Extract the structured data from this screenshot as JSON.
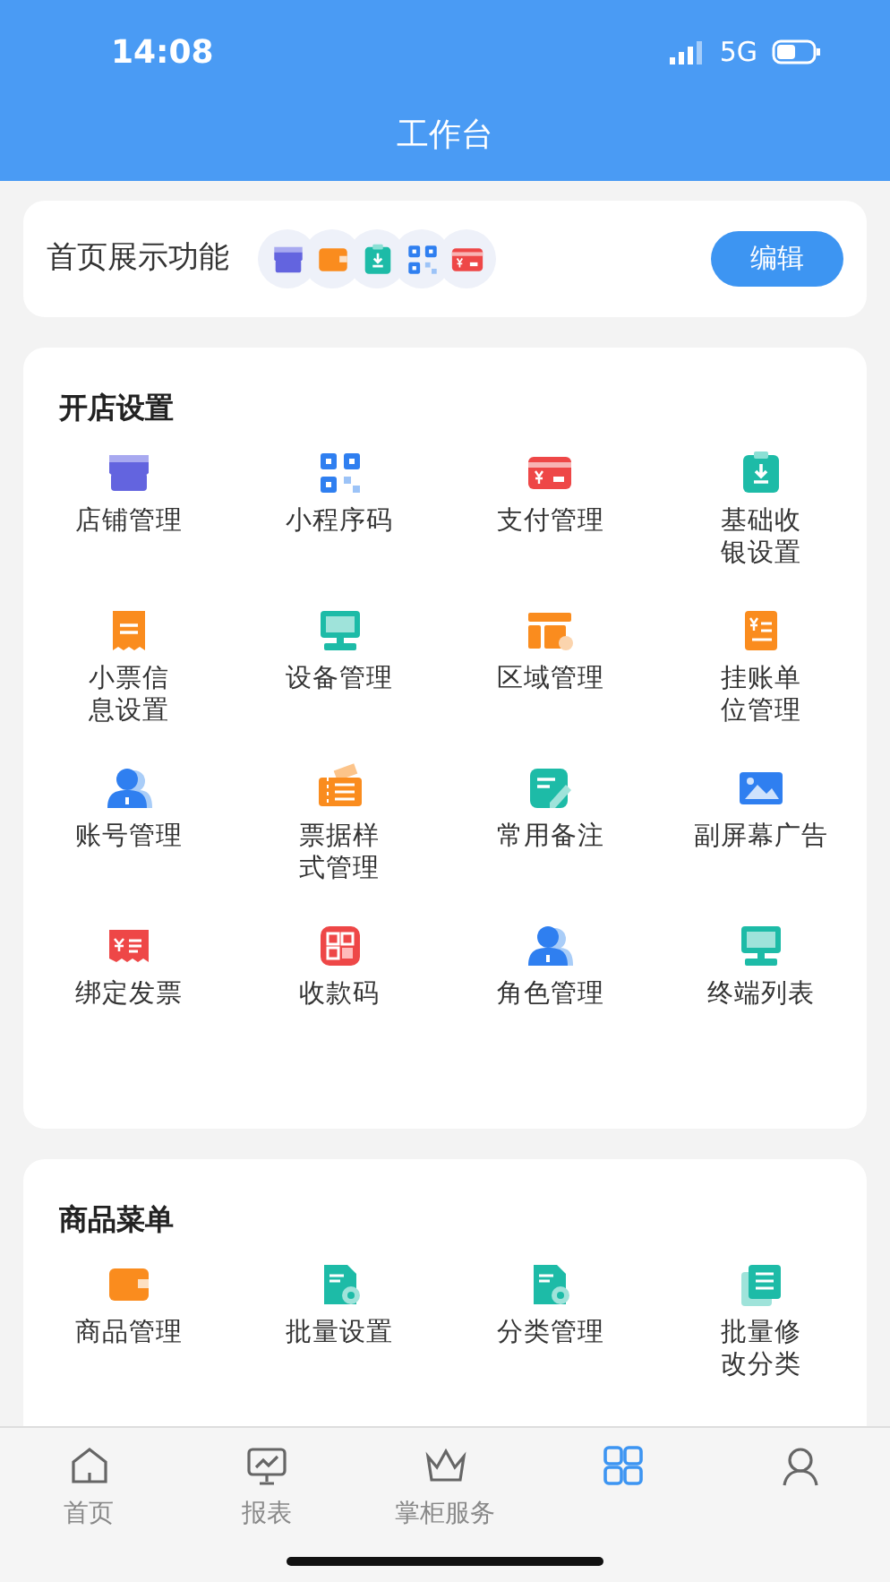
{
  "status_bar": {
    "time": "14:08",
    "network": "5G"
  },
  "header": {
    "title": "工作台"
  },
  "home_display": {
    "label": "首页展示功能",
    "button": "编辑"
  },
  "sections": [
    {
      "title": "开店设置",
      "items": [
        {
          "label": "店铺管理"
        },
        {
          "label": "小程序码"
        },
        {
          "label": "支付管理"
        },
        {
          "label": "基础收银设置"
        },
        {
          "label": "小票信息设置"
        },
        {
          "label": "设备管理"
        },
        {
          "label": "区域管理"
        },
        {
          "label": "挂账单位管理"
        },
        {
          "label": "账号管理"
        },
        {
          "label": "票据样式管理"
        },
        {
          "label": "常用备注"
        },
        {
          "label": "副屏幕广告"
        },
        {
          "label": "绑定发票"
        },
        {
          "label": "收款码"
        },
        {
          "label": "角色管理"
        },
        {
          "label": "终端列表"
        }
      ]
    },
    {
      "title": "商品菜单",
      "items": [
        {
          "label": "商品管理"
        },
        {
          "label": "批量设置"
        },
        {
          "label": "分类管理"
        },
        {
          "label": "批量修改分类"
        }
      ]
    }
  ],
  "tab_bar": [
    {
      "label": "首页",
      "selected": false
    },
    {
      "label": "报表",
      "selected": false
    },
    {
      "label": "掌柜服务",
      "selected": false
    },
    {
      "selected": true
    },
    {
      "selected": false
    }
  ]
}
